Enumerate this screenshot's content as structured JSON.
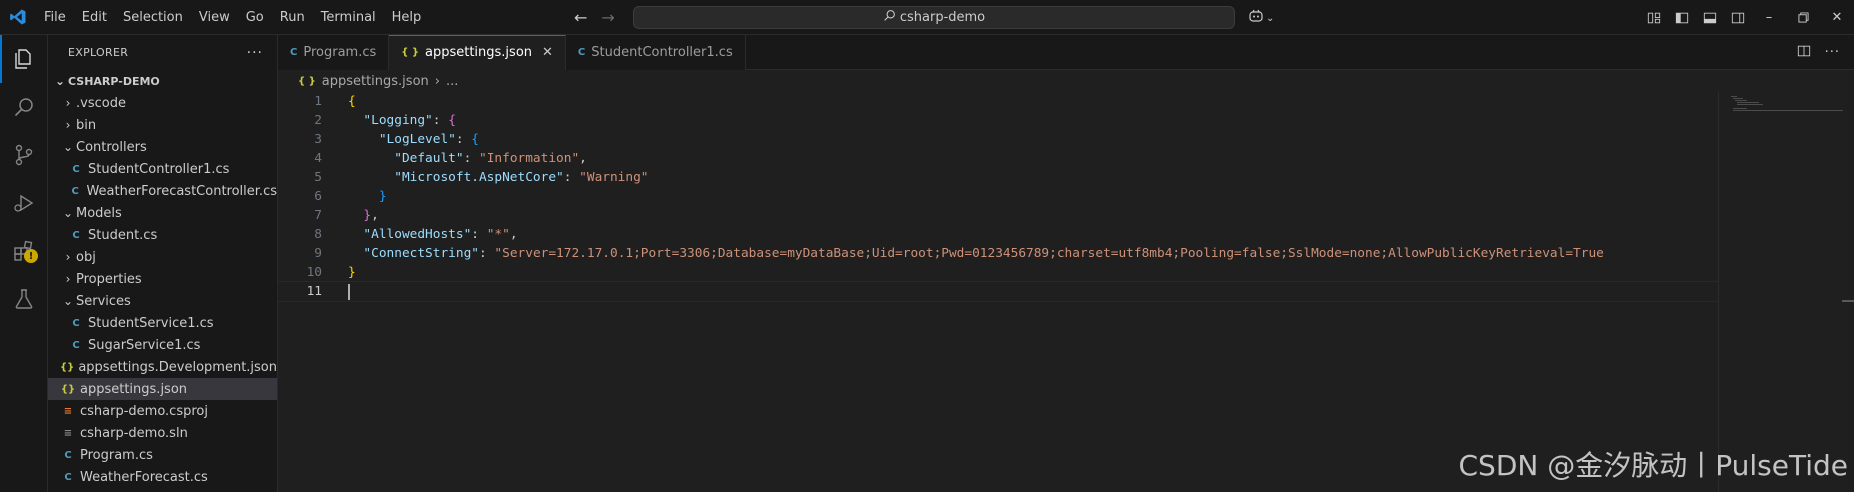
{
  "menu": [
    "File",
    "Edit",
    "Selection",
    "View",
    "Go",
    "Run",
    "Terminal",
    "Help"
  ],
  "search": {
    "text": "csharp-demo"
  },
  "explorer": {
    "title": "EXPLORER",
    "more": "···",
    "root": "CSHARP-DEMO",
    "items": [
      {
        "label": ".vscode",
        "type": "folder",
        "expanded": false,
        "depth": 1
      },
      {
        "label": "bin",
        "type": "folder",
        "expanded": false,
        "depth": 1
      },
      {
        "label": "Controllers",
        "type": "folder",
        "expanded": true,
        "depth": 1
      },
      {
        "label": "StudentController1.cs",
        "type": "cs",
        "depth": 2
      },
      {
        "label": "WeatherForecastController.cs",
        "type": "cs",
        "depth": 2
      },
      {
        "label": "Models",
        "type": "folder",
        "expanded": true,
        "depth": 1
      },
      {
        "label": "Student.cs",
        "type": "cs",
        "depth": 2
      },
      {
        "label": "obj",
        "type": "folder",
        "expanded": false,
        "depth": 1
      },
      {
        "label": "Properties",
        "type": "folder",
        "expanded": false,
        "depth": 1
      },
      {
        "label": "Services",
        "type": "folder",
        "expanded": true,
        "depth": 1
      },
      {
        "label": "StudentService1.cs",
        "type": "cs",
        "depth": 2
      },
      {
        "label": "SugarService1.cs",
        "type": "cs",
        "depth": 2
      },
      {
        "label": "appsettings.Development.json",
        "type": "json",
        "depth": 1
      },
      {
        "label": "appsettings.json",
        "type": "json",
        "depth": 1,
        "selected": true
      },
      {
        "label": "csharp-demo.csproj",
        "type": "rss",
        "depth": 1
      },
      {
        "label": "csharp-demo.sln",
        "type": "sln",
        "depth": 1
      },
      {
        "label": "Program.cs",
        "type": "cs",
        "depth": 1
      },
      {
        "label": "WeatherForecast.cs",
        "type": "cs",
        "depth": 1
      }
    ]
  },
  "tabs": [
    {
      "label": "Program.cs",
      "icon": "C",
      "type": "cs",
      "active": false
    },
    {
      "label": "appsettings.json",
      "icon": "{ }",
      "type": "json",
      "active": true
    },
    {
      "label": "StudentController1.cs",
      "icon": "C",
      "type": "cs",
      "active": false
    }
  ],
  "breadcrumb": {
    "file": "appsettings.json",
    "rest": "..."
  },
  "code": {
    "line_numbers": [
      "1",
      "2",
      "3",
      "4",
      "5",
      "6",
      "7",
      "8",
      "9",
      "10",
      "11"
    ],
    "logging_key": "\"Logging\"",
    "loglevel_key": "\"LogLevel\"",
    "default_key": "\"Default\"",
    "default_val": "\"Information\"",
    "ms_key": "\"Microsoft.AspNetCore\"",
    "ms_val": "\"Warning\"",
    "hosts_key": "\"AllowedHosts\"",
    "hosts_val": "\"*\"",
    "conn_key": "\"ConnectString\"",
    "conn_val": "\"Server=172.17.0.1;Port=3306;Database=myDataBase;Uid=root;Pwd=0123456789;charset=utf8mb4;Pooling=false;SslMode=none;AllowPublicKeyRetrieval=True"
  },
  "watermark": "CSDN @金汐脉动丨PulseTide",
  "colors": {
    "accent": "#0078d4",
    "key": "#9cdcfe",
    "string": "#ce9178",
    "warning_badge": "#cca700"
  }
}
